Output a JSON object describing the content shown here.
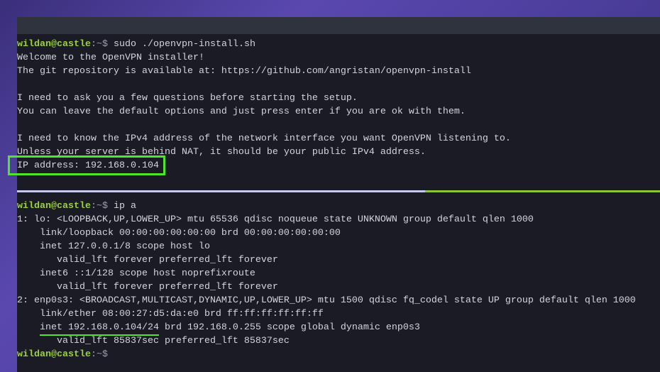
{
  "prompt": {
    "user_host": "wildan@castle",
    "sep": ":",
    "path_sigil": "~$"
  },
  "session1": {
    "command": " sudo ./openvpn-install.sh",
    "output": [
      "Welcome to the OpenVPN installer!",
      "The git repository is available at: https://github.com/angristan/openvpn-install",
      "",
      "I need to ask you a few questions before starting the setup.",
      "You can leave the default options and just press enter if you are ok with them.",
      "",
      "I need to know the IPv4 address of the network interface you want OpenVPN listening to.",
      "Unless your server is behind NAT, it should be your public IPv4 address.",
      "IP address: 192.168.0.104"
    ]
  },
  "session2": {
    "command": " ip a",
    "output": [
      "1: lo: <LOOPBACK,UP,LOWER_UP> mtu 65536 qdisc noqueue state UNKNOWN group default qlen 1000",
      "    link/loopback 00:00:00:00:00:00 brd 00:00:00:00:00:00",
      "    inet 127.0.0.1/8 scope host lo",
      "       valid_lft forever preferred_lft forever",
      "    inet6 ::1/128 scope host noprefixroute",
      "       valid_lft forever preferred_lft forever",
      "2: enp0s3: <BROADCAST,MULTICAST,DYNAMIC,UP,LOWER_UP> mtu 1500 qdisc fq_codel state UP group default qlen 1000",
      "    link/ether 08:00:27:d5:da:e0 brd ff:ff:ff:ff:ff:ff",
      "    inet 192.168.0.104/24 brd 192.168.0.255 scope global dynamic enp0s3",
      "       valid_lft 85837sec preferred_lft 85837sec"
    ],
    "final_prompt": ""
  },
  "colors": {
    "prompt": "#9bd13e",
    "highlight": "#4ee52a",
    "bg": "#1b1b26"
  }
}
